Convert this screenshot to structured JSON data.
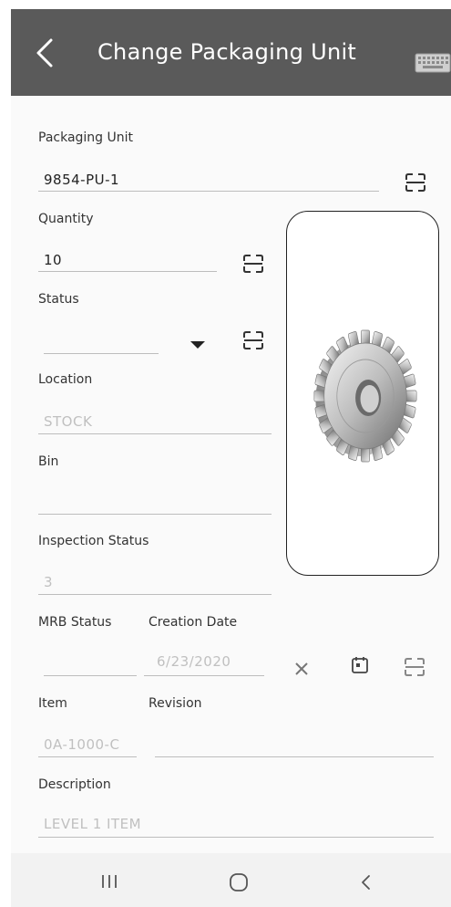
{
  "header": {
    "title": "Change Packaging Unit",
    "back_icon": "chevron-left-icon",
    "keyboard_icon": "keyboard-icon",
    "background": "#5a5a5a"
  },
  "form": {
    "packaging_unit": {
      "label": "Packaging Unit",
      "value": "9854-PU-1"
    },
    "quantity": {
      "label": "Quantity",
      "value": "10"
    },
    "status": {
      "label": "Status",
      "value": ""
    },
    "location": {
      "label": "Location",
      "value": "STOCK"
    },
    "bin": {
      "label": "Bin",
      "value": ""
    },
    "inspection_status": {
      "label": "Inspection Status",
      "value": "3"
    },
    "mrb_status": {
      "label": "MRB Status",
      "value": ""
    },
    "creation_date": {
      "label": "Creation Date",
      "value": "6/23/2020"
    },
    "item": {
      "label": "Item",
      "value": "0A-1000-C"
    },
    "revision": {
      "label": "Revision",
      "value": ""
    },
    "description": {
      "label": "Description",
      "value": "LEVEL 1 ITEM"
    }
  },
  "icons": {
    "scan": "barcode-scan-icon",
    "dropdown": "caret-down-icon",
    "clear": "close-icon",
    "calendar": "calendar-icon",
    "part_image": "gear-image"
  },
  "navbar": {
    "recents": "recent-apps-icon",
    "home": "home-icon",
    "back": "back-icon"
  }
}
